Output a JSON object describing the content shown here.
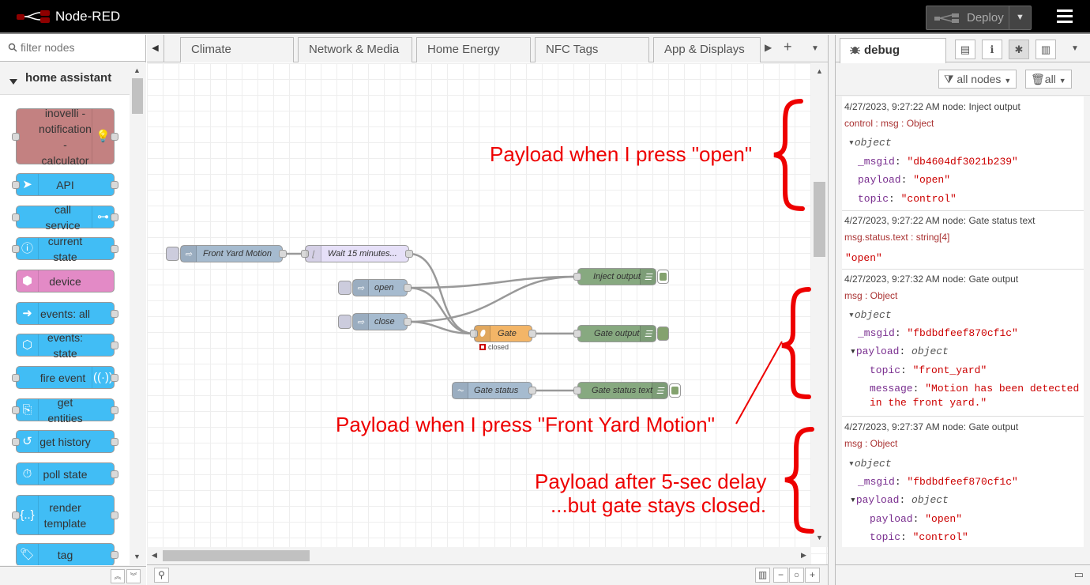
{
  "app": {
    "title": "Node-RED",
    "deploy_label": "Deploy"
  },
  "palette": {
    "filter_placeholder": "filter nodes",
    "category": "home assistant",
    "nodes": [
      {
        "label": "inovelli - notification - calculator",
        "color": "#c38181",
        "icon": "lightbulb-icon"
      },
      {
        "label": "API",
        "color": "#41bdf5",
        "icon": "send-icon"
      },
      {
        "label": "call service",
        "color": "#41bdf5",
        "icon": "router-icon"
      },
      {
        "label": "current state",
        "color": "#41bdf5",
        "icon": "info-icon"
      },
      {
        "label": "device",
        "color": "#e38ac6",
        "icon": "cube-icon"
      },
      {
        "label": "events: all",
        "color": "#41bdf5",
        "icon": "arrow-right-icon"
      },
      {
        "label": "events: state",
        "color": "#41bdf5",
        "icon": "arrow-hexagon-icon"
      },
      {
        "label": "fire event",
        "color": "#41bdf5",
        "icon": "broadcast-icon"
      },
      {
        "label": "get entities",
        "color": "#41bdf5",
        "icon": "search-document-icon"
      },
      {
        "label": "get history",
        "color": "#41bdf5",
        "icon": "history-icon"
      },
      {
        "label": "poll state",
        "color": "#41bdf5",
        "icon": "timer-icon"
      },
      {
        "label": "render template",
        "color": "#41bdf5",
        "icon": "braces-icon"
      },
      {
        "label": "tag",
        "color": "#41bdf5",
        "icon": "tag-icon"
      }
    ]
  },
  "tabs": [
    "Climate",
    "Network & Media",
    "Home Energy",
    "NFC Tags",
    "App & Displays"
  ],
  "flow": {
    "nodes": {
      "front_yard_motion": "Front Yard Motion",
      "wait": "Wait 15 minutes...",
      "open": "open",
      "close": "close",
      "inject_output": "Inject output",
      "gate": "Gate",
      "gate_status_label": "closed",
      "gate_output": "Gate output",
      "gate_status": "Gate status",
      "gate_status_text": "Gate status text"
    }
  },
  "annotations": {
    "a1": "Payload when I press \"open\"",
    "a2": "Payload when I press \"Front Yard Motion\"",
    "a3_line1": "Payload after 5-sec delay",
    "a3_line2": "...but gate stays closed."
  },
  "sidebar": {
    "tab": "debug",
    "filter_nodes": "all nodes",
    "clear": "all",
    "messages": [
      {
        "meta": "4/27/2023, 9:27:22 AM   node: Inject output",
        "topic": "control : msg : Object",
        "type": "object",
        "fields": [
          [
            "_msgid",
            "\"db4604df3021b239\""
          ],
          [
            "payload",
            "\"open\""
          ],
          [
            "topic",
            "\"control\""
          ]
        ]
      },
      {
        "meta": "4/27/2023, 9:27:22 AM   node: Gate status text",
        "topic": "msg.status.text : string[4]",
        "value": "\"open\""
      },
      {
        "meta": "4/27/2023, 9:27:32 AM   node: Gate output",
        "topic": "msg : Object",
        "type": "object",
        "msgid": "\"fbdbdfeef870cf1c\"",
        "payload_type": "object",
        "p_topic": "\"front_yard\"",
        "p_message": "\"Motion has been detected",
        "p_message2": "in the front yard.\""
      },
      {
        "meta": "4/27/2023, 9:27:37 AM   node: Gate output",
        "topic": "msg : Object",
        "type": "object",
        "msgid": "\"fbdbdfeef870cf1c\"",
        "payload_type": "object",
        "p_payload": "\"open\"",
        "p_topic": "\"control\""
      }
    ]
  }
}
